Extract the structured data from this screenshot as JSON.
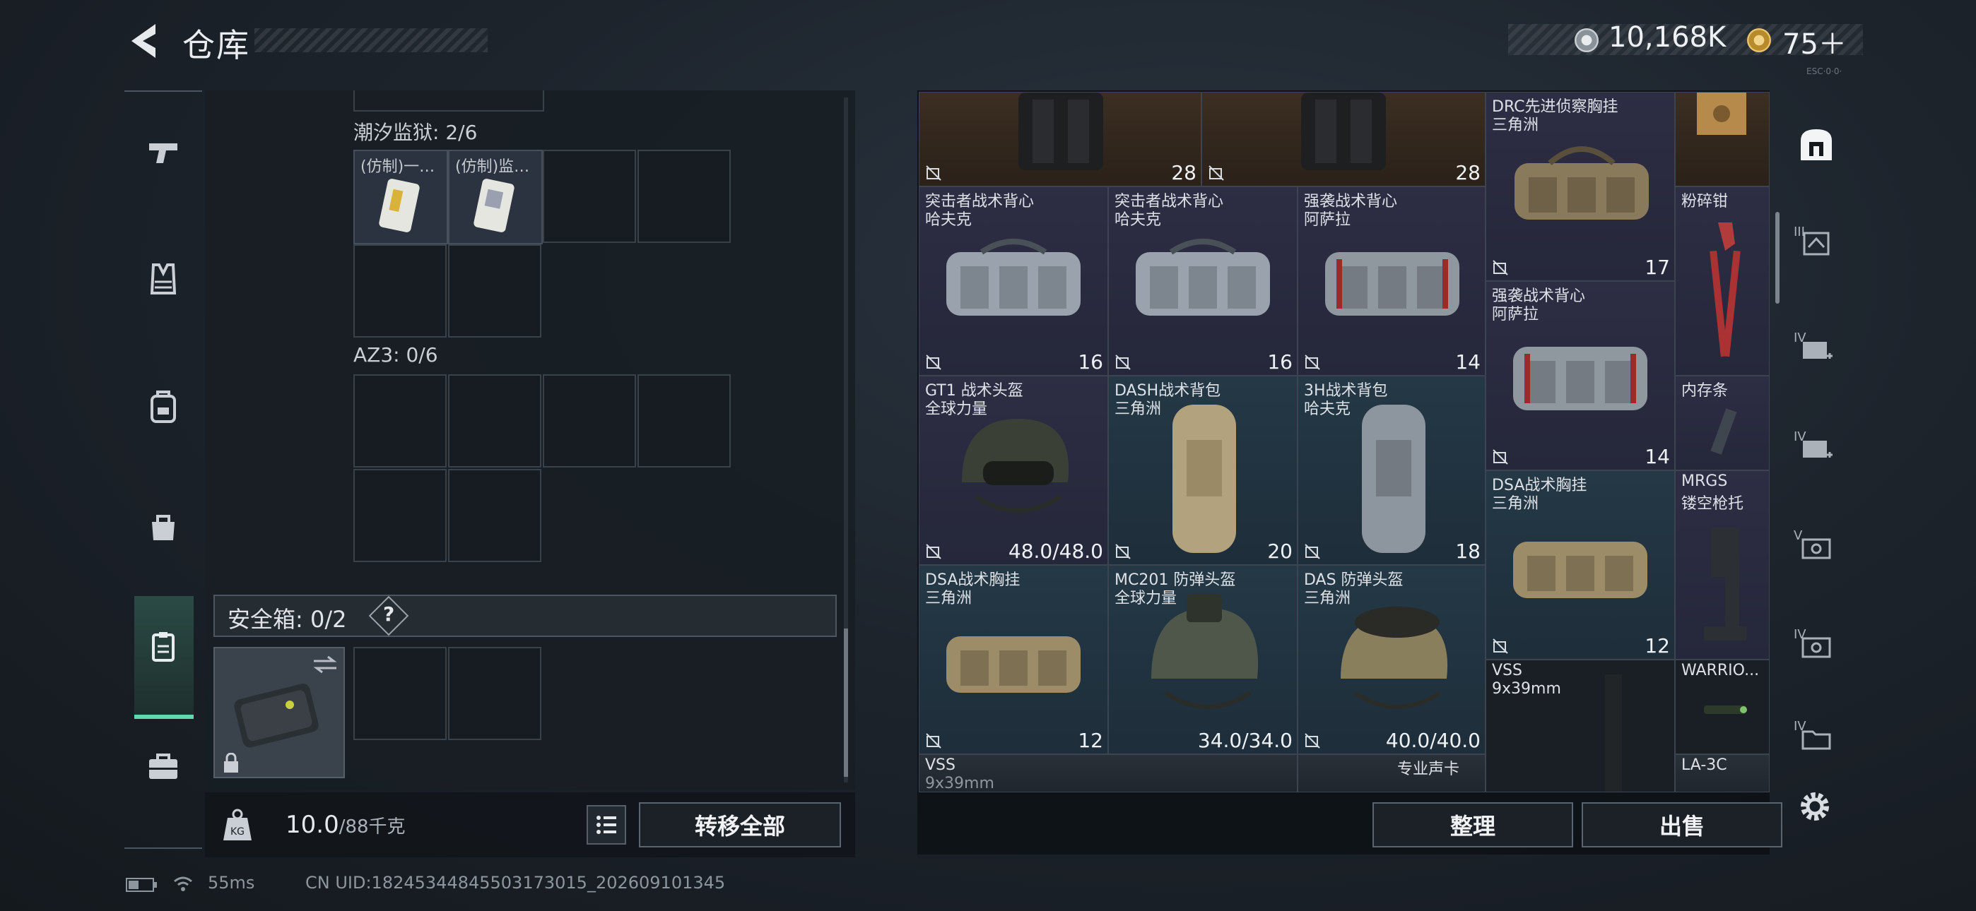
{
  "header": {
    "title": "仓库",
    "currency_silver": "10,168K",
    "currency_gold": "75＋",
    "version_tag": "ESC·0·0·"
  },
  "left_panel": {
    "section_1_label": "潮汐监狱: 2/6",
    "section_1_items": [
      "(仿制)一…",
      "(仿制)监…"
    ],
    "section_2_label": "AZ3: 0/6",
    "secure_box_label": "安全箱: 0/2",
    "help_label": "?",
    "weight_value": "10.0",
    "weight_unit": "/88千克",
    "transfer_all_label": "转移全部"
  },
  "storage": {
    "tiles": {
      "top_1_value": "28",
      "top_2_value": "28",
      "drc_name": "DRC先进侦察胸挂",
      "drc_brand": "三角洲",
      "drc_value": "17",
      "assault_1_name": "突击者战术背心",
      "assault_1_brand": "哈夫克",
      "assault_1_value": "16",
      "assault_2_name": "突击者战术背心",
      "assault_2_brand": "哈夫克",
      "assault_2_value": "16",
      "strong_1_name": "强袭战术背心",
      "strong_1_brand": "阿萨拉",
      "strong_1_value": "14",
      "crusher_name": "粉碎钳",
      "strong_2_name": "强袭战术背心",
      "strong_2_brand": "阿萨拉",
      "strong_2_value": "14",
      "memory_name": "内存条",
      "gt1_name": "GT1 战术头盔",
      "gt1_brand": "全球力量",
      "gt1_value": "48.0/48.0",
      "dash_name": "DASH战术背包",
      "dash_brand": "三角洲",
      "dash_value": "20",
      "bag3h_name": "3H战术背包",
      "bag3h_brand": "哈夫克",
      "bag3h_value": "18",
      "dsa_1_name": "DSA战术胸挂",
      "dsa_1_brand": "三角洲",
      "dsa_1_value": "12",
      "mrgs_name": "MRGS",
      "mrgs_sub": "镂空枪托",
      "dsa_2_name": "DSA战术胸挂",
      "dsa_2_brand": "三角洲",
      "dsa_2_value": "12",
      "mc201_name": "MC201 防弹头盔",
      "mc201_brand": "全球力量",
      "mc201_value": "34.0/34.0",
      "das_name": "DAS 防弹头盔",
      "das_brand": "三角洲",
      "das_value": "40.0/40.0",
      "vss_1_name": "VSS",
      "vss_1_sub": "9x39mm",
      "warrior_name": "WARRIO...",
      "vss_2_name": "VSS",
      "vss_2_sub": "9x39mm",
      "card_name": "专业声卡",
      "la3c_name": "LA-3C"
    },
    "sort_label": "整理",
    "sell_label": "出售"
  },
  "filter_sidebar": {
    "levels": [
      "III",
      "IV",
      "IV",
      "V",
      "IV",
      "IV"
    ]
  },
  "status_bar": {
    "ping": "55ms",
    "uid": "CN UID:1824534484550317301​5_202609101345"
  },
  "colors": {
    "accent": "#5fd8b0",
    "tile_purple": "#2d2d44",
    "tile_teal": "#243846",
    "tile_brown": "#3c2e22"
  }
}
